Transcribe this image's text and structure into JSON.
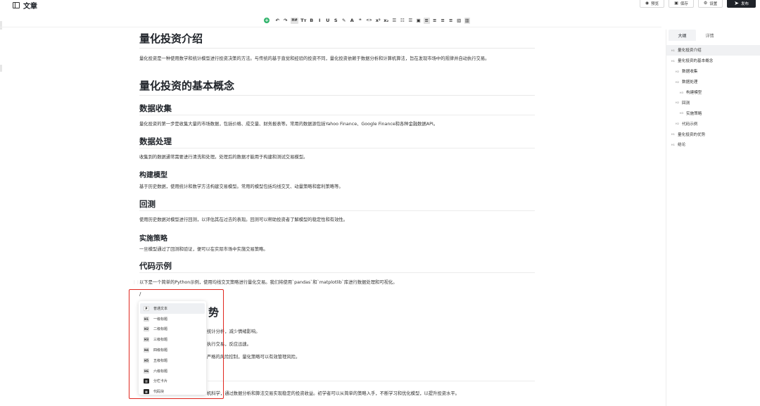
{
  "header": {
    "title": "文章",
    "buttons": [
      {
        "icon": "eye-icon",
        "glyph": "◉",
        "label": "预览"
      },
      {
        "icon": "save-icon",
        "glyph": "▣",
        "label": "保存"
      },
      {
        "icon": "gear-icon",
        "glyph": "⚙",
        "label": "设置"
      },
      {
        "icon": "send-icon",
        "glyph": "➤",
        "label": "发布"
      }
    ]
  },
  "toolbar": [
    "+",
    "↶",
    "↷",
    "H#",
    "Tт",
    "B",
    "I",
    "U",
    "S",
    "✎",
    "A",
    "❝",
    "<>",
    "x²",
    "x₂",
    "☰",
    "☷",
    "☰",
    "▣",
    "≡",
    "≡",
    "≡",
    "≡",
    "▧",
    "▥"
  ],
  "document": {
    "title": "量化投资介绍",
    "intro": "量化投资是一种使用数学和统计模型进行投资决策的方法。与传统的基于直觉和经验的投资不同，量化投资依赖于数据分析和计算机算法，旨在发现市场中的规律并自动执行交易。",
    "h_concepts": "量化投资的基本概念",
    "h_data_collect": "数据收集",
    "p_data_collect": "量化投资的第一步是收集大量的市场数据，包括价格、成交量、财务报表等。常用的数据源包括Yahoo Finance、Google Finance和各种金融数据API。",
    "h_data_process": "数据处理",
    "p_data_process": "收集到的数据通常需要进行清洗和处理。处理后的数据才能用于构建和测试交易模型。",
    "h_build_model": "构建模型",
    "p_build_model": "基于历史数据，使用统计和数学方法构建交易模型。常用的模型包括均线交叉、动量策略和套利策略等。",
    "h_backtest": "回测",
    "p_backtest": "使用历史数据对模型进行回测，以评估其在过去的表现。回测可以帮助投资者了解模型的稳定性和有效性。",
    "h_implement": "实施策略",
    "p_implement": "一旦模型通过了回测和验证，便可以在实际市场中实施交易策略。",
    "h_code": "代码示例",
    "p_code": "以下是一个简单的Python示例，使用均线交叉策略进行量化交易。我们将使用`pandas`和`matplotlib`库进行数据处理和可视化。",
    "slash": "/",
    "covered_heading": "势",
    "partial_lines": [
      "统计分析，减少情绪影响。",
      "执行交易，反应迅速。",
      "严格的风险控制，量化策略可以有效管理风险。"
    ],
    "conclusion_partial": "机科学，通过数据分析和算法交易实现稳定的投资收益。初学者可以从简单的策略入手，不断学习和优化模型，以提升投资水平。"
  },
  "slash_menu": [
    {
      "icon": "P",
      "label": "普通文本"
    },
    {
      "icon": "H1",
      "label": "一级标题"
    },
    {
      "icon": "H2",
      "label": "二级标题"
    },
    {
      "icon": "H3",
      "label": "三级标题"
    },
    {
      "icon": "H4",
      "label": "四级标题"
    },
    {
      "icon": "H5",
      "label": "五级标题"
    },
    {
      "icon": "H6",
      "label": "六级标题"
    },
    {
      "icon": "▥",
      "label": "分栏卡片"
    },
    {
      "icon": "▦",
      "label": "代码块"
    }
  ],
  "panel": {
    "tabs": [
      "大纲",
      "详情"
    ],
    "outline": [
      {
        "level": "H1",
        "label": "量化投资介绍",
        "indent": 0
      },
      {
        "level": "H1",
        "label": "量化投资的基本概念",
        "indent": 0
      },
      {
        "level": "H2",
        "label": "数据收集",
        "indent": 1
      },
      {
        "level": "H2",
        "label": "数据处理",
        "indent": 1
      },
      {
        "level": "H3",
        "label": "构建模型",
        "indent": 2
      },
      {
        "level": "H2",
        "label": "回测",
        "indent": 1
      },
      {
        "level": "H3",
        "label": "实施策略",
        "indent": 2
      },
      {
        "level": "H2",
        "label": "代码示例",
        "indent": 1
      },
      {
        "level": "H1",
        "label": "量化投资的优势",
        "indent": 0
      },
      {
        "level": "H1",
        "label": "结论",
        "indent": 0
      }
    ]
  }
}
